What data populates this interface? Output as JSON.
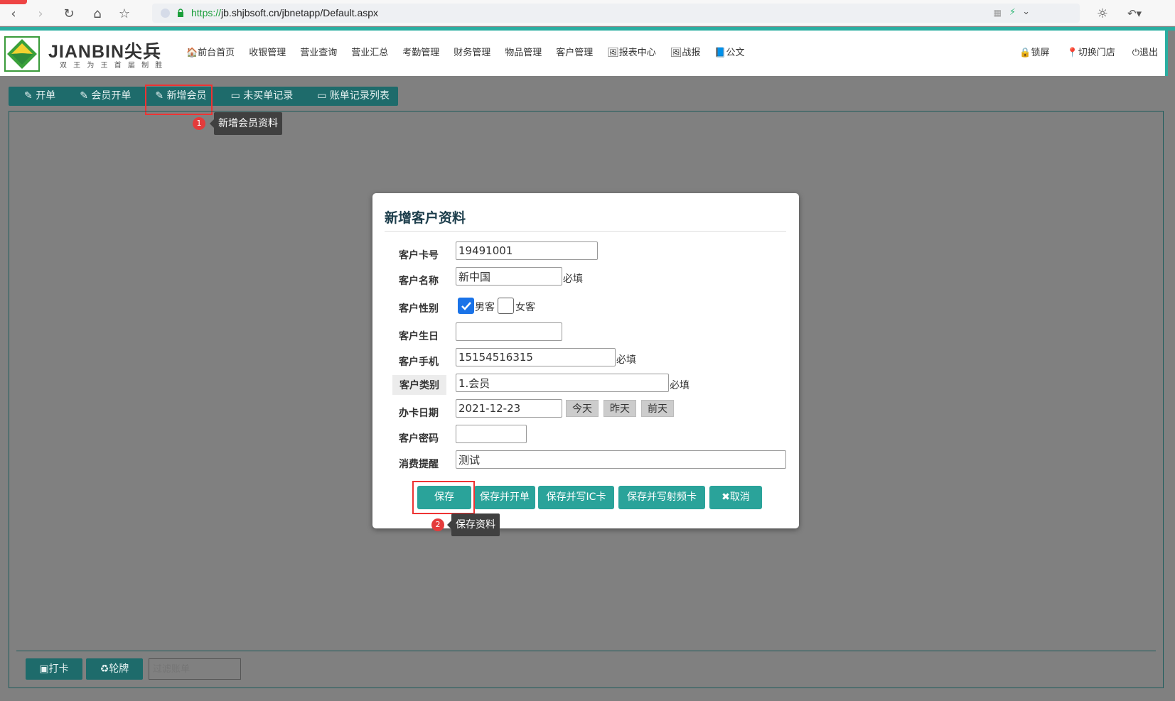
{
  "browser": {
    "url_https": "https://",
    "url_rest": "jb.shjbsoft.cn/jbnetapp/Default.aspx"
  },
  "logo": {
    "title": "JIANBIN尖兵",
    "slogan": "双 王 为 王   首 届 制 胜"
  },
  "top_nav": [
    "🏠前台首页",
    "收银管理",
    "营业查询",
    "营业汇总",
    "考勤管理",
    "财务管理",
    "物品管理",
    "客户管理",
    "🖼报表中心",
    "🖼战报",
    "📘公文"
  ],
  "right_nav": [
    "🔒锁屏",
    "📍切换门店",
    "⏻退出"
  ],
  "tabs": [
    "开单",
    "会员开单",
    "新增会员",
    "未买单记录",
    "账单记录列表"
  ],
  "tooltip1": {
    "badge": "1",
    "text": "新增会员资料"
  },
  "modal": {
    "title": "新增客户资料",
    "labels": {
      "card_no": "客户卡号",
      "name": "客户名称",
      "gender": "客户性别",
      "birthday": "客户生日",
      "phone": "客户手机",
      "category": "客户类别",
      "card_date": "办卡日期",
      "password": "客户密码",
      "reminder": "消费提醒"
    },
    "values": {
      "card_no": "19491001",
      "name": "新中国",
      "birthday": "",
      "phone": "15154516315",
      "category": "1.会员",
      "card_date": "2021-12-23",
      "password": "",
      "reminder": "测试"
    },
    "required": "必填",
    "gender_male": "男客",
    "gender_female": "女客",
    "date_buttons": [
      "今天",
      "昨天",
      "前天"
    ],
    "actions": [
      "保存",
      "保存并开单",
      "保存并写IC卡",
      "保存并写射频卡",
      "✖取消"
    ]
  },
  "tooltip2": {
    "badge": "2",
    "text": "保存资料"
  },
  "footer": {
    "punch_btn": "打卡",
    "rotate_btn": "轮牌",
    "filter_placeholder": "过滤账单"
  },
  "colors": {
    "accent_teal": "#2aaea1",
    "tab_bg": "#1e6b6b",
    "highlight_red": "#e33333"
  }
}
